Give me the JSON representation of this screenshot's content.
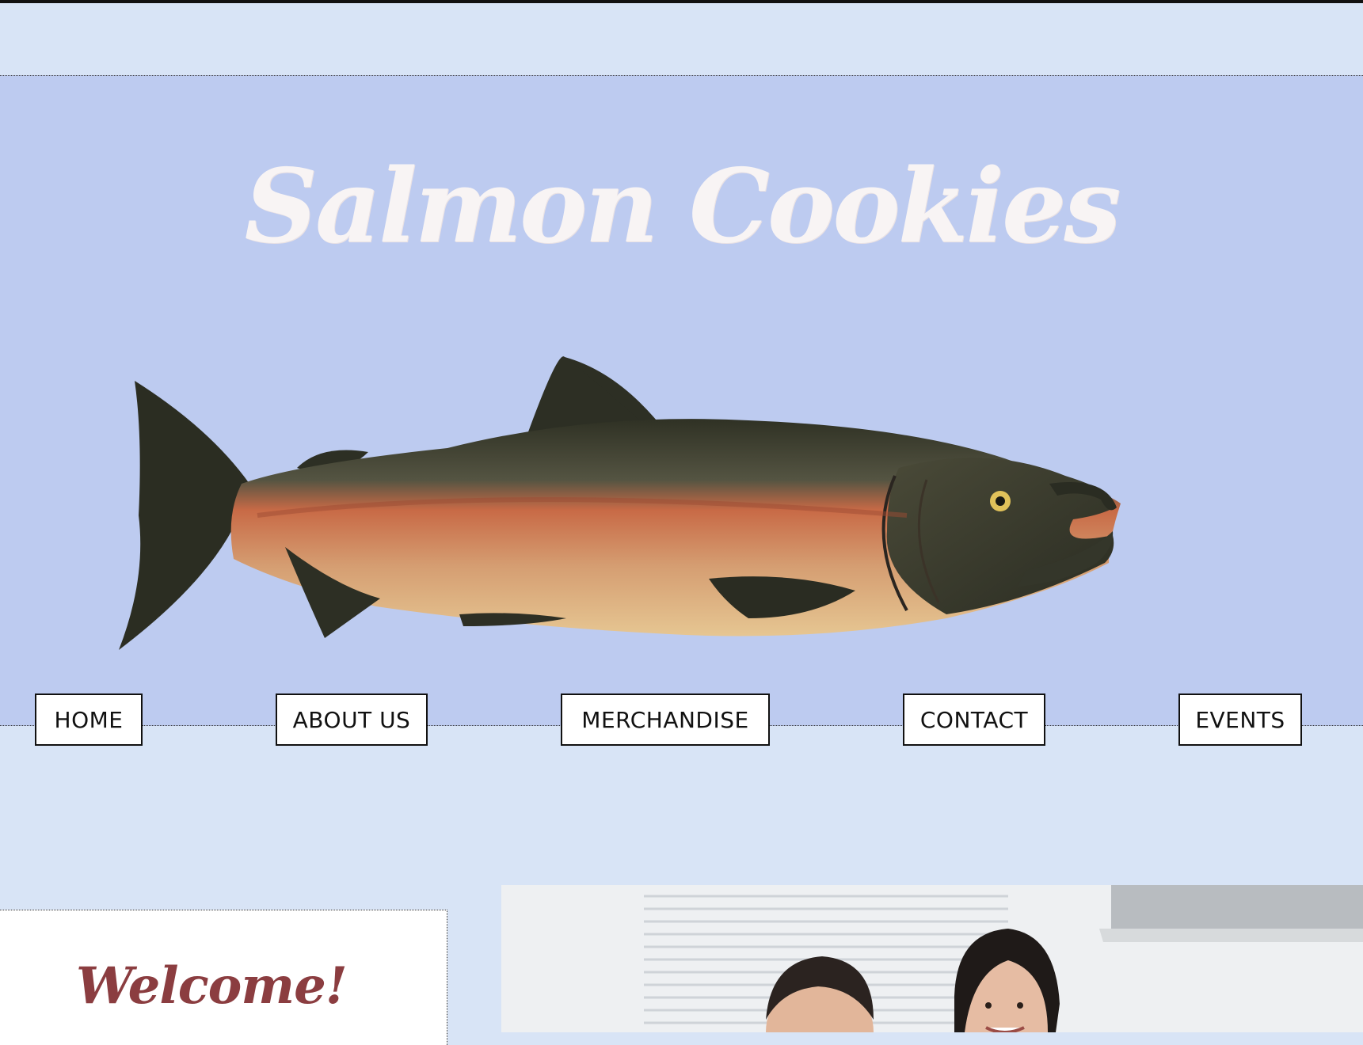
{
  "header": {
    "site_title": "Salmon Cookies"
  },
  "hero_image": {
    "icon": "salmon-fish-illustration"
  },
  "nav": {
    "items": [
      {
        "label": "HOME"
      },
      {
        "label": "ABOUT US"
      },
      {
        "label": "MERCHANDISE"
      },
      {
        "label": "CONTACT"
      },
      {
        "label": "EVENTS"
      }
    ]
  },
  "welcome": {
    "title": "Welcome!"
  },
  "photo": {
    "icon": "people-photo"
  },
  "colors": {
    "page_bg": "#d8e4f6",
    "hero_bg": "#bdcbf0",
    "title_color": "#f8f4f4",
    "welcome_color": "#8b3d40"
  }
}
